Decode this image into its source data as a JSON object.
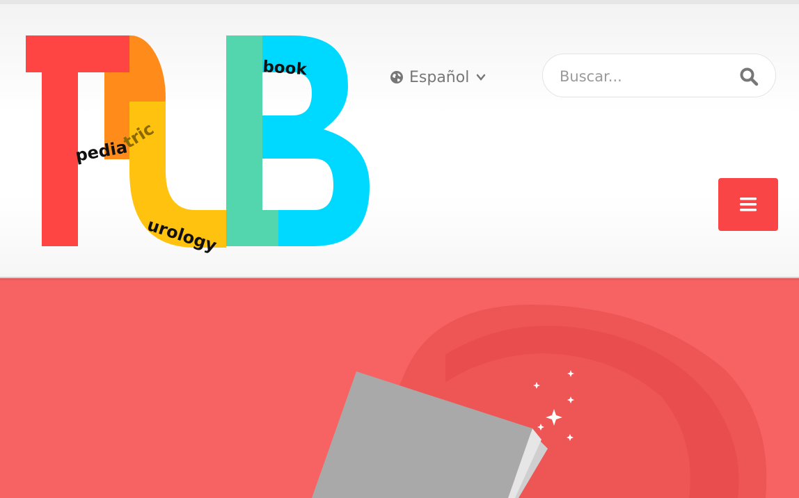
{
  "logo": {
    "letters": "PUB",
    "words": {
      "pediatric": "pediatric",
      "pedia": "pedia",
      "tric": "tric",
      "urology": "urology",
      "book": "book"
    },
    "colors": {
      "red": "#ff4444",
      "orange": "#ff8c1a",
      "yellow": "#ffc20e",
      "green": "#53d5ad",
      "cyan": "#00d9ff"
    }
  },
  "language": {
    "icon": "globe-icon",
    "label": "Español",
    "chevron": "chevron-down-icon"
  },
  "search": {
    "placeholder": "Buscar...",
    "icon": "search-icon"
  },
  "menu": {
    "icon": "hamburger-icon",
    "color": "#f94545"
  },
  "hero": {
    "background": "#f76262",
    "illustration": "book-with-sparkles"
  }
}
